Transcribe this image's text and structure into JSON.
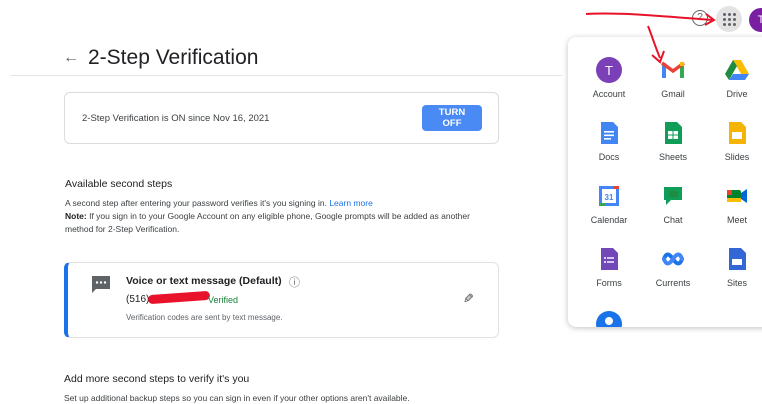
{
  "header": {
    "back_icon": "arrow-left-icon",
    "title": "2-Step Verification"
  },
  "status": {
    "text": "2-Step Verification is ON since Nov 16, 2021",
    "turn_off_label": "TURN OFF"
  },
  "available": {
    "heading": "Available second steps",
    "desc_text": "A second step after entering your password verifies it's you signing in. ",
    "learn_more": "Learn more",
    "note_label": "Note:",
    "note_text": " If you sign in to your Google Account on any eligible phone, Google prompts will be added as another method for 2-Step Verification."
  },
  "voice_step": {
    "icon": "sms-icon",
    "title": "Voice or text message (Default)",
    "phone_prefix": "(516)",
    "verified": "Verified",
    "note": "Verification codes are sent by text message."
  },
  "more_steps": {
    "heading": "Add more second steps to verify it's you",
    "desc": "Set up additional backup steps so you can sign in even if your other options aren't available."
  },
  "topbar": {
    "help_glyph": "?",
    "avatar_letter": "T"
  },
  "apps": [
    {
      "label": "Account",
      "icon": "account-icon"
    },
    {
      "label": "Gmail",
      "icon": "gmail-icon"
    },
    {
      "label": "Drive",
      "icon": "drive-icon"
    },
    {
      "label": "Docs",
      "icon": "docs-icon"
    },
    {
      "label": "Sheets",
      "icon": "sheets-icon"
    },
    {
      "label": "Slides",
      "icon": "slides-icon"
    },
    {
      "label": "Calendar",
      "icon": "calendar-icon"
    },
    {
      "label": "Chat",
      "icon": "chat-icon"
    },
    {
      "label": "Meet",
      "icon": "meet-icon"
    },
    {
      "label": "Forms",
      "icon": "forms-icon"
    },
    {
      "label": "Currents",
      "icon": "currents-icon"
    },
    {
      "label": "Sites",
      "icon": "sites-icon"
    }
  ],
  "app_icon_letters": {
    "account": "T",
    "calendar": "31"
  },
  "colors": {
    "accent": "#1a73e8",
    "button": "#4a8af4",
    "verified": "#188038",
    "annotation": "#e8132a"
  }
}
